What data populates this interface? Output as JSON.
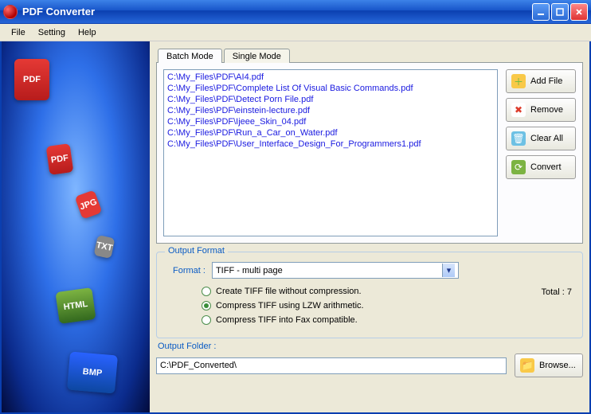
{
  "app": {
    "title": "PDF Converter"
  },
  "menu": {
    "file": "File",
    "setting": "Setting",
    "help": "Help"
  },
  "tabs": {
    "batch": "Batch Mode",
    "single": "Single Mode"
  },
  "files": [
    "C:\\My_Files\\PDF\\AI4.pdf",
    "C:\\My_Files\\PDF\\Complete List Of Visual Basic Commands.pdf",
    "C:\\My_Files\\PDF\\Detect Porn File.pdf",
    "C:\\My_Files\\PDF\\einstein-lecture.pdf",
    "C:\\My_Files\\PDF\\Ijeee_Skin_04.pdf",
    "C:\\My_Files\\PDF\\Run_a_Car_on_Water.pdf",
    "C:\\My_Files\\PDF\\User_Interface_Design_For_Programmers1.pdf"
  ],
  "buttons": {
    "add_file": "Add File",
    "remove": "Remove",
    "clear_all": "Clear All",
    "convert": "Convert",
    "browse": "Browse..."
  },
  "output": {
    "group_label": "Output Format",
    "format_label": "Format :",
    "format_value": "TIFF - multi page",
    "radios": {
      "no_compress": "Create TIFF file without compression.",
      "lzw": "Compress TIFF using LZW arithmetic.",
      "fax": "Compress TIFF into Fax compatible."
    },
    "total_label": "Total : 7",
    "folder_label": "Output Folder :",
    "folder_value": "C:\\PDF_Converted\\"
  },
  "deco": {
    "pdf": "PDF",
    "html": "HTML",
    "bmp": "BMP",
    "jpg": "JPG",
    "txt": "TXT"
  }
}
